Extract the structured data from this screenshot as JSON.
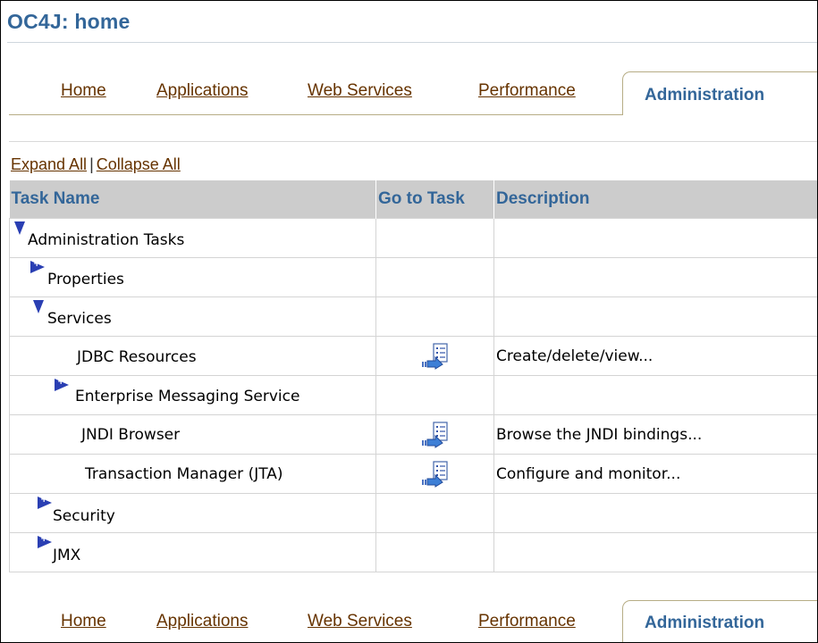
{
  "page": {
    "title": "OC4J: home"
  },
  "tabs": [
    {
      "label": "Home"
    },
    {
      "label": "Applications"
    },
    {
      "label": "Web Services"
    },
    {
      "label": "Performance"
    },
    {
      "label": "Administration",
      "active": true
    }
  ],
  "controls": {
    "expand_all": "Expand All",
    "separator": "|",
    "collapse_all": "Collapse All"
  },
  "table": {
    "columns": [
      "Task Name",
      "Go to Task",
      "Description"
    ],
    "rows": [
      {
        "name": "Administration Tasks",
        "state": "expanded",
        "go": false,
        "desc": ""
      },
      {
        "name": "Properties",
        "state": "collapsed",
        "go": false,
        "desc": ""
      },
      {
        "name": "Services",
        "state": "expanded",
        "go": false,
        "desc": ""
      },
      {
        "name": "JDBC Resources",
        "state": "leaf",
        "go": true,
        "desc": "Create/delete/view..."
      },
      {
        "name": "Enterprise Messaging Service",
        "state": "collapsed",
        "go": false,
        "desc": ""
      },
      {
        "name": "JNDI Browser",
        "state": "leaf",
        "go": true,
        "desc": "Browse the JNDI bindings..."
      },
      {
        "name": "Transaction Manager (JTA)",
        "state": "leaf",
        "go": true,
        "desc": "Configure and monitor..."
      },
      {
        "name": "Security",
        "state": "collapsed",
        "go": false,
        "desc": ""
      },
      {
        "name": "JMX",
        "state": "collapsed",
        "go": false,
        "desc": ""
      }
    ]
  },
  "icons": {
    "expanded": "triangle-down-icon",
    "collapsed": "triangle-right-plus-icon",
    "go_to_task": "go-to-task-icon"
  },
  "colors": {
    "title": "#336699",
    "link": "#663300",
    "header_bg": "#cccccc",
    "triangle": "#2a3fb3"
  }
}
